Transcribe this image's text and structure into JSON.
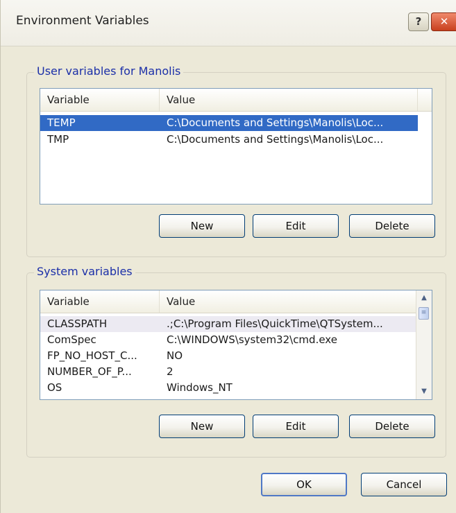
{
  "window": {
    "title": "Environment Variables",
    "help_glyph": "?",
    "close_glyph": "✕"
  },
  "user_group": {
    "label": "User variables for Manolis",
    "columns": [
      "Variable",
      "Value"
    ],
    "rows": [
      {
        "variable": "TEMP",
        "value": "C:\\Documents and Settings\\Manolis\\Loc...",
        "selected": true
      },
      {
        "variable": "TMP",
        "value": "C:\\Documents and Settings\\Manolis\\Loc...",
        "selected": false
      }
    ],
    "buttons": {
      "new": "New",
      "edit": "Edit",
      "delete": "Delete"
    }
  },
  "system_group": {
    "label": "System variables",
    "columns": [
      "Variable",
      "Value"
    ],
    "rows": [
      {
        "variable": "CLASSPATH",
        "value": ".;C:\\Program Files\\QuickTime\\QTSystem..."
      },
      {
        "variable": "ComSpec",
        "value": "C:\\WINDOWS\\system32\\cmd.exe"
      },
      {
        "variable": "FP_NO_HOST_C...",
        "value": "NO"
      },
      {
        "variable": "NUMBER_OF_P...",
        "value": "2"
      },
      {
        "variable": "OS",
        "value": "Windows_NT"
      }
    ],
    "buttons": {
      "new": "New",
      "edit": "Edit",
      "delete": "Delete"
    }
  },
  "footer": {
    "ok": "OK",
    "cancel": "Cancel"
  },
  "colors": {
    "selection": "#316ac5",
    "group_label": "#1b2fa8",
    "dialog_bg": "#ece9d8"
  }
}
